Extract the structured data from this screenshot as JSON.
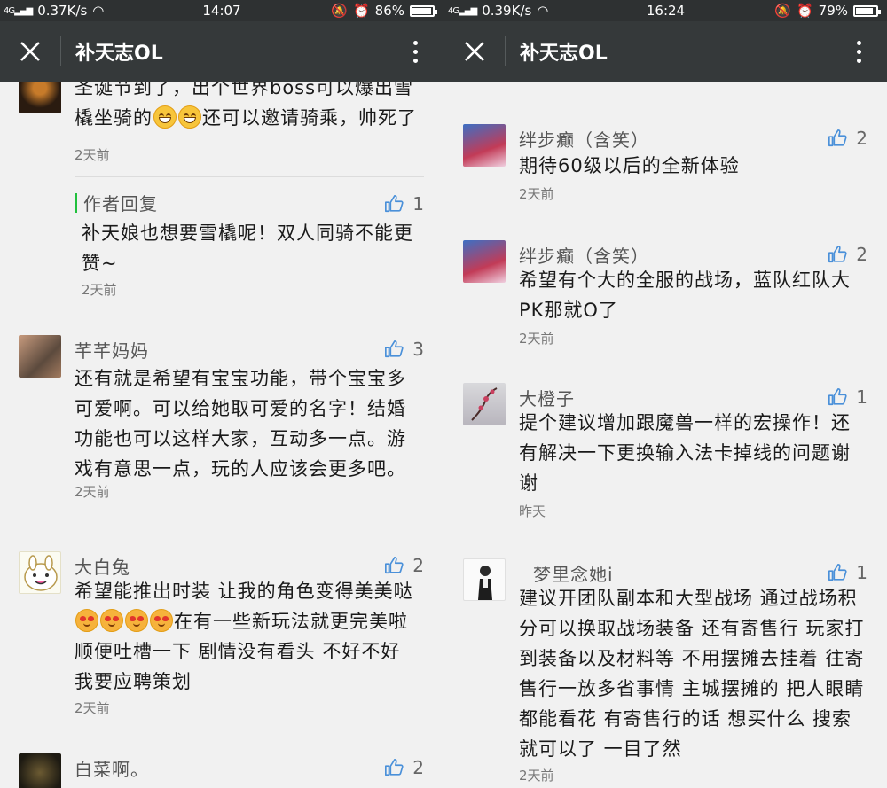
{
  "app_title": "补天志OL",
  "screens": [
    {
      "status": {
        "speed": "0.37K/s",
        "time": "14:07",
        "battery": "86%",
        "battery_level": 0.86
      },
      "comments": [
        {
          "text_pre": "圣诞节到了，出个世界boss可以爆出雪橇坐骑的",
          "text_post": "还可以邀请骑乘，帅死了",
          "time": "2天前",
          "reply": {
            "author": "作者回复",
            "likes": "1",
            "text": "补天娘也想要雪橇呢！双人同骑不能更赞~",
            "time": "2天前"
          }
        },
        {
          "name": "芊芊妈妈",
          "likes": "3",
          "text": "还有就是希望有宝宝功能，带个宝宝多可爱啊。可以给她取可爱的名字！结婚功能也可以这样大家，互动多一点。游戏有意思一点，玩的人应该会更多吧。",
          "time": "2天前"
        },
        {
          "name": "大白兔",
          "likes": "2",
          "text_pre": "希望能推出时装 让我的角色变得美美哒",
          "text_post": "在有一些新玩法就更完美啦 顺便吐槽一下 剧情没有看头 不好不好 我要应聘策划",
          "time": "2天前"
        },
        {
          "name": "白菜啊。",
          "likes": "2"
        }
      ]
    },
    {
      "status": {
        "speed": "0.39K/s",
        "time": "16:24",
        "battery": "79%",
        "battery_level": 0.79
      },
      "comments": [
        {
          "name": "绊步癫（含笑）",
          "likes": "2",
          "text": "期待60级以后的全新体验",
          "time": "2天前"
        },
        {
          "name": "绊步癫（含笑）",
          "likes": "2",
          "text": "希望有个大的全服的战场，蓝队红队大PK那就O了",
          "time": "2天前"
        },
        {
          "name": "大橙子",
          "likes": "1",
          "text": "提个建议增加跟魔兽一样的宏操作！还有解决一下更换输入法卡掉线的问题谢谢",
          "time": "昨天"
        },
        {
          "name": "梦里念她i",
          "likes": "1",
          "text": "建议开团队副本和大型战场 通过战场积分可以换取战场装备 还有寄售行 玩家打到装备以及材料等 不用摆摊去挂着 往寄售行一放多省事情 主城摆摊的 把人眼睛都能看花 有寄售行的话 想买什么  搜索就可以了 一目了然",
          "time": "2天前"
        }
      ]
    }
  ]
}
